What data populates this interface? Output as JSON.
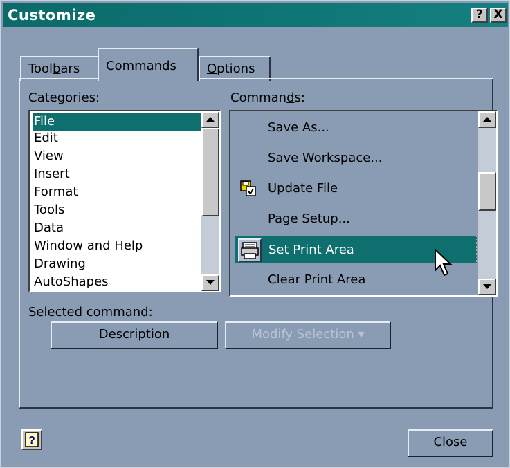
{
  "window": {
    "title": "Customize",
    "help_glyph": "?",
    "close_glyph": "X"
  },
  "tabs": [
    {
      "label_pre": "Tool",
      "label_acc": "b",
      "label_post": "ars"
    },
    {
      "label_pre": "",
      "label_acc": "C",
      "label_post": "ommands"
    },
    {
      "label_pre": "",
      "label_acc": "O",
      "label_post": "ptions"
    }
  ],
  "categories": {
    "label_pre": "Cate",
    "label_acc": "g",
    "label_post": "ories:",
    "items": [
      "File",
      "Edit",
      "View",
      "Insert",
      "Format",
      "Tools",
      "Data",
      "Window and Help",
      "Drawing",
      "AutoShapes"
    ],
    "selected": "File"
  },
  "commands": {
    "label_pre": "Comman",
    "label_acc": "d",
    "label_post": "s:",
    "items": [
      {
        "label": "Save As...",
        "icon": ""
      },
      {
        "label": "Save Workspace...",
        "icon": ""
      },
      {
        "label": "Update File",
        "icon": "update-file-icon"
      },
      {
        "label": "Page Setup...",
        "icon": ""
      },
      {
        "label": "Set Print Area",
        "icon": "set-print-area-icon"
      },
      {
        "label": "Clear Print Area",
        "icon": ""
      }
    ],
    "selected": "Set Print Area"
  },
  "selected_command": {
    "label": "Selected command:",
    "description_pre": "Descri",
    "description_acc": "p",
    "description_post": "tion",
    "modify": "Modify Selection"
  },
  "footer": {
    "close_label": "Close"
  },
  "colors": {
    "dialog_bg": "#8a9cb4",
    "titlebar": "#0f7676",
    "selection": "#0f6f6f"
  }
}
